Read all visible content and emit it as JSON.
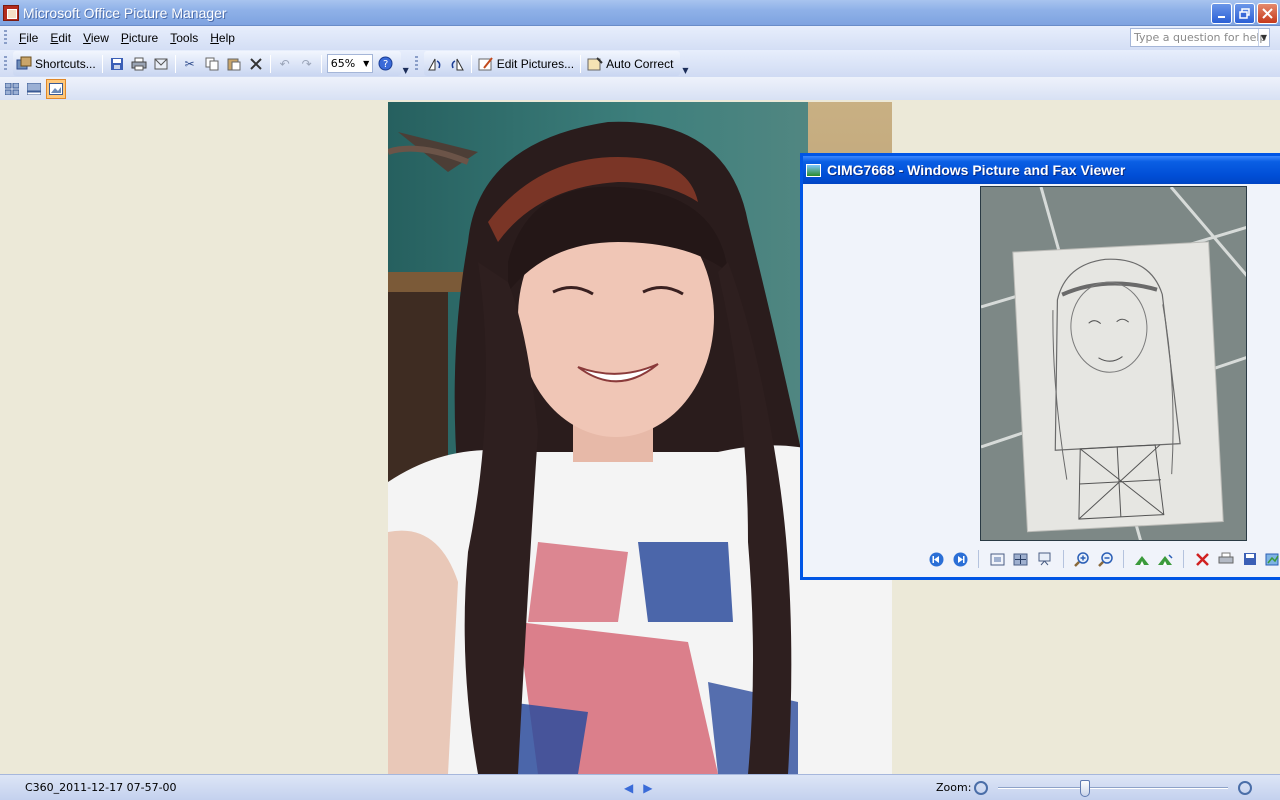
{
  "window": {
    "title": "Microsoft Office Picture Manager",
    "controls": [
      "minimize",
      "restore",
      "close"
    ]
  },
  "menu": {
    "items": [
      {
        "label": "File",
        "accel": "F"
      },
      {
        "label": "Edit",
        "accel": "E"
      },
      {
        "label": "View",
        "accel": "V"
      },
      {
        "label": "Picture",
        "accel": "P"
      },
      {
        "label": "Tools",
        "accel": "T"
      },
      {
        "label": "Help",
        "accel": "H"
      }
    ],
    "help_placeholder": "Type a question for help"
  },
  "toolbar": {
    "shortcuts_label": "Shortcuts...",
    "zoom_value": "65%",
    "edit_pictures_label": "Edit Pictures...",
    "auto_correct_label": "Auto Correct",
    "icons": [
      "save-icon",
      "print-icon",
      "email-icon",
      "cut-icon",
      "copy-icon",
      "paste-icon",
      "delete-icon",
      "undo-icon",
      "redo-icon",
      "help-icon",
      "rotate-left-icon",
      "rotate-right-icon"
    ]
  },
  "view_toolbar": {
    "modes": [
      "thumbnail-view",
      "filmstrip-view",
      "single-picture-view"
    ],
    "active": "single-picture-view"
  },
  "status": {
    "filename": "C360_2011-12-17 07-57-00",
    "zoom_label": "Zoom:",
    "zoom_fraction": 0.38
  },
  "fax_viewer": {
    "title": "CIMG7668 - Windows Picture and Fax Viewer",
    "tools": [
      "previous-image-icon",
      "next-image-icon",
      "best-fit-icon",
      "actual-size-icon",
      "slideshow-icon",
      "zoom-in-icon",
      "zoom-out-icon",
      "rotate-clockwise-icon",
      "rotate-counterclockwise-icon",
      "delete-icon",
      "print-icon",
      "save-icon",
      "edit-icon"
    ]
  },
  "colors": {
    "xp_title_blue": "#0055e5",
    "office_title": "#8fb1e8",
    "canvas_bg": "#ece9d8",
    "active_view": "#ffc87a"
  }
}
